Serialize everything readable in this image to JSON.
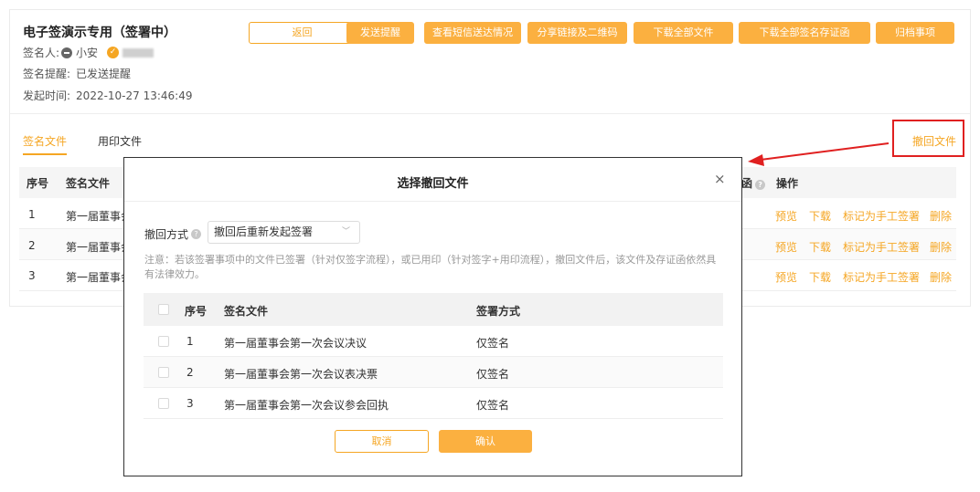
{
  "header": {
    "title": "电子签演示专用（签署中）",
    "signer_label": "签名人:",
    "signer_name": "小安",
    "reminder_label": "签名提醒:",
    "reminder_value": "已发送提醒",
    "start_label": "发起时间:",
    "start_value": "2022-10-27 13:46:49"
  },
  "toolbar": {
    "back": "返回",
    "send_reminder": "发送提醒",
    "sms_status": "查看短信送达情况",
    "share_link": "分享链接及二维码",
    "download_all": "下载全部文件",
    "download_certs": "下载全部签名存证函",
    "archive": "归档事项"
  },
  "tabs": {
    "sign_files": "签名文件",
    "seal_files": "用印文件"
  },
  "recall_link": "撤回文件",
  "bg_table": {
    "headers": {
      "index": "序号",
      "file": "签名文件",
      "cert_suffix": "函",
      "ops": "操作"
    },
    "rows": [
      {
        "index": "1",
        "file": "第一届董事会"
      },
      {
        "index": "2",
        "file": "第一届董事会"
      },
      {
        "index": "3",
        "file": "第一届董事会"
      }
    ],
    "ops": {
      "preview": "预览",
      "download": "下载",
      "mark_manual": "标记为手工签署",
      "delete": "删除"
    }
  },
  "modal": {
    "title": "选择撤回文件",
    "close": "×",
    "mode_label": "撤回方式",
    "mode_value": "撤回后重新发起签署",
    "notice": "注意：若该签署事项中的文件已签署（针对仅签字流程），或已用印（针对签字+用印流程），撤回文件后，该文件及存证函依然具有法律效力。",
    "table": {
      "headers": {
        "index": "序号",
        "file": "签名文件",
        "method": "签署方式"
      },
      "rows": [
        {
          "index": "1",
          "file": "第一届董事会第一次会议决议",
          "method": "仅签名"
        },
        {
          "index": "2",
          "file": "第一届董事会第一次会议表决票",
          "method": "仅签名"
        },
        {
          "index": "3",
          "file": "第一届董事会第一次会议参会回执",
          "method": "仅签名"
        }
      ]
    },
    "cancel": "取消",
    "confirm": "确认"
  },
  "colors": {
    "accent": "#f5a623",
    "annotation": "#e02020"
  }
}
